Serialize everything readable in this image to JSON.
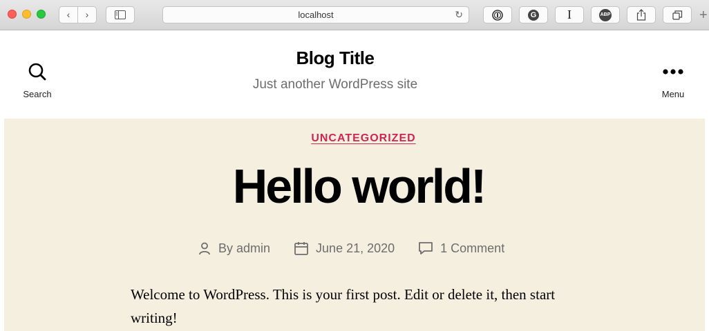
{
  "browser": {
    "address": "localhost",
    "buttons": {
      "back": "‹",
      "forward": "›",
      "reload": "↻",
      "ext_grammarly": "G",
      "ext_instapaper": "I",
      "ext_abp": "ABP",
      "plus": "+"
    }
  },
  "site": {
    "title": "Blog Title",
    "description": "Just another WordPress site",
    "search_label": "Search",
    "menu_label": "Menu"
  },
  "post": {
    "category": "UNCATEGORIZED",
    "title": "Hello world!",
    "author": "By admin",
    "date": "June 21, 2020",
    "comments": "1 Comment",
    "excerpt": "Welcome to WordPress. This is your first post. Edit or delete it, then start writing!"
  },
  "colors": {
    "accent": "#cd2653",
    "post_background": "#f5efe0",
    "meta_text": "#6d6d6d"
  }
}
